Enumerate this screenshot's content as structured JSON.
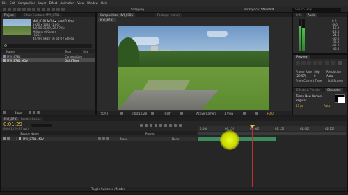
{
  "menu": [
    "File",
    "Edit",
    "Composition",
    "Layer",
    "Effect",
    "Animation",
    "View",
    "Window",
    "Help"
  ],
  "toolbar": {
    "snapping": "Snapping",
    "workspace_label": "Workspace:",
    "workspace_value": "Standard",
    "search_placeholder": "Search Help"
  },
  "project": {
    "tabs": [
      "Project",
      "Effect Controls: MVI_8781"
    ],
    "item_name": "MVI_8781.MOV ▾, used 1 time",
    "meta": [
      "1920 x 1080 (1.00)",
      "Δ 0;00;30;09, 29.97 fps",
      "Millions of Colors",
      "H.264",
      "48.000 kHz / 16 bit U / Stereo"
    ],
    "columns": [
      "Name",
      "Type",
      "Size"
    ],
    "rows": [
      {
        "name": "MVI_8781",
        "type": "Composition"
      },
      {
        "name": "MVI_8781.MOV",
        "type": "QuickTime"
      }
    ],
    "footer": "8 bpc"
  },
  "composition": {
    "tabs": [
      "Composition: MVI_8781",
      "Footage: (none)"
    ],
    "sub_tab": "MVI_8781",
    "footer": {
      "zoom": "(50%)",
      "timecode": "0;00;10;28",
      "quality": "(Half)",
      "view": "Active Camera",
      "views": "1 View",
      "offset": "+0.0"
    }
  },
  "audio": {
    "tabs": [
      "Info",
      "Audio"
    ],
    "scale": [
      "0.0",
      "-6.0",
      "-12.0",
      "-18.0",
      "-24.0",
      "-30.0",
      "-36.0",
      "-42.0",
      "-48.0"
    ]
  },
  "preview": {
    "title": "Preview",
    "labels": [
      "Frame Rate",
      "Skip",
      "Resolution"
    ],
    "values": [
      "(29.97)",
      "0",
      "Auto"
    ],
    "from_current": "From Current Time",
    "full_screen": "Full Screen",
    "effects_presets": "Effects & Presets",
    "character": "Character",
    "font": "Times New Roman",
    "font_style": "Regular",
    "font_size": "47 px",
    "leading": "Auto"
  },
  "timeline": {
    "tabs": [
      "MVI_8781",
      "Render Queue"
    ],
    "timecode": "0;01;29",
    "timecode_sub": "00041 (29.97 fps)",
    "columns": [
      "Source Name",
      "Parent"
    ],
    "layer": {
      "index": "1",
      "name": "MVI_8781.MOV",
      "parent": "None"
    },
    "ruler": [
      "0:00f",
      "00:15f",
      "01:00f",
      "01:15f",
      "02:00f",
      "02:15f"
    ],
    "footer": "Toggle Switches / Modes"
  },
  "colors": {
    "accent": "#e8ff1a",
    "playhead": "#c03030",
    "track": "#3d8a5f"
  }
}
